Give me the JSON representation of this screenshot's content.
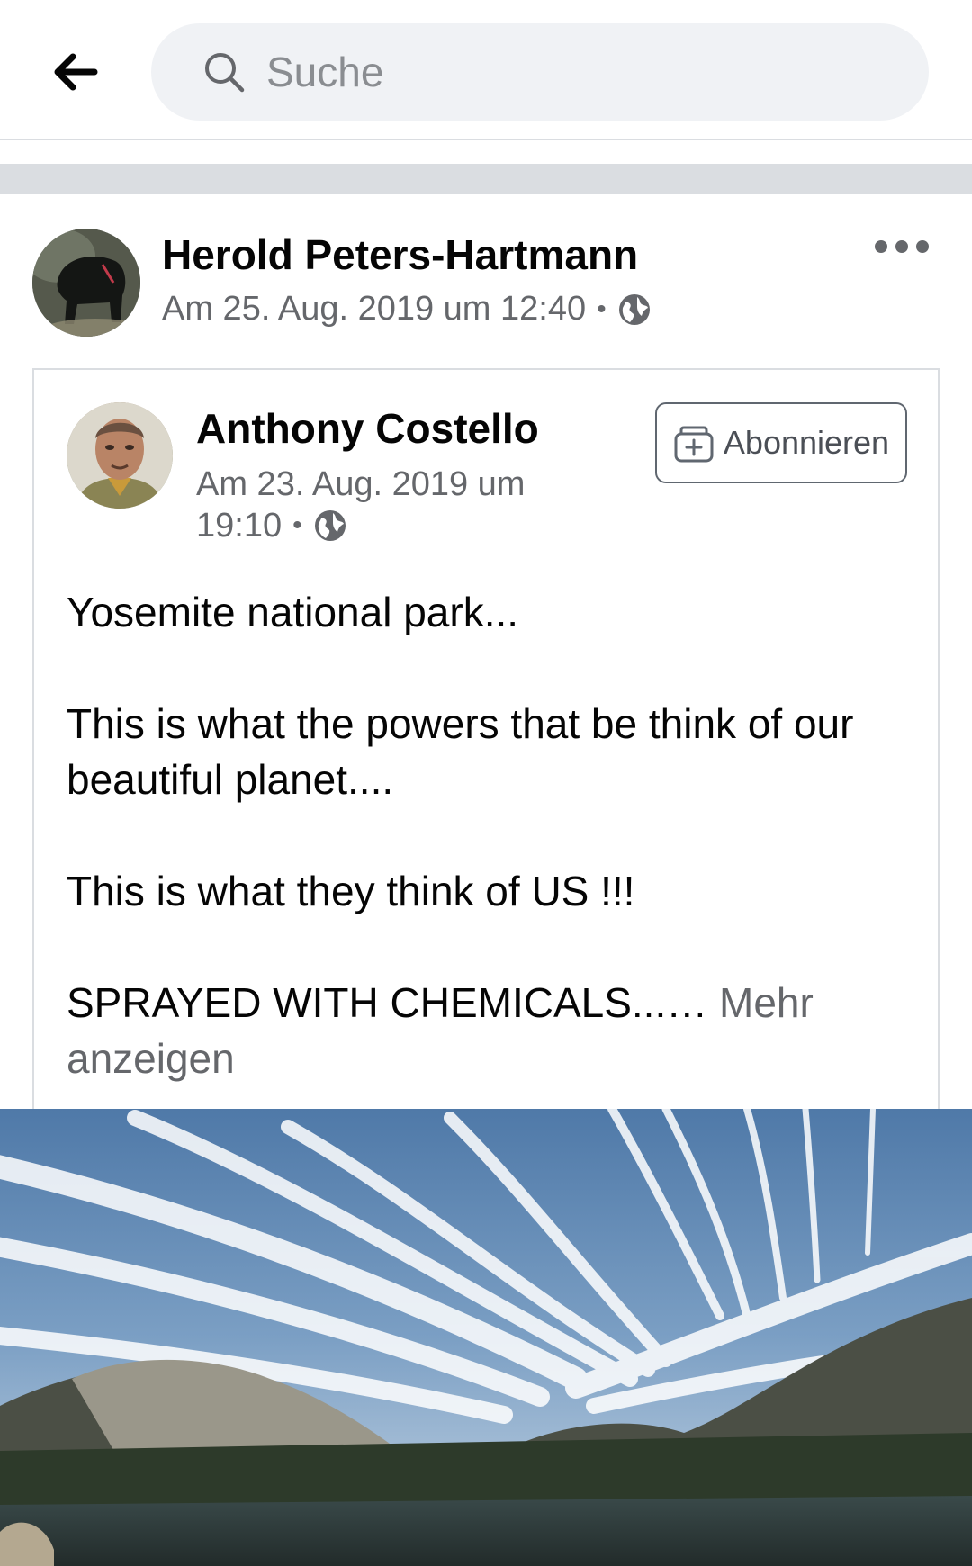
{
  "search": {
    "placeholder": "Suche"
  },
  "post": {
    "author": "Herold Peters-Hartmann",
    "timestamp": "Am 25. Aug. 2019 um 12:40",
    "separator": "•",
    "privacy_icon": "globe-icon"
  },
  "shared_post": {
    "author": "Anthony Costello",
    "timestamp_line1": "Am 23. Aug. 2019 um",
    "timestamp_line2": "19:10",
    "separator": "•",
    "follow_label": "Abonnieren",
    "text": {
      "p1": "Yosemite national park...",
      "p2": "This is what the powers that be think of our beautiful planet....",
      "p3": "This is what they think of US !!!",
      "p4": "SPRAYED WITH CHEMICALS...…",
      "see_more": "Mehr anzeigen"
    }
  },
  "colors": {
    "secondary_text": "#65676b",
    "search_bg": "#f0f2f5",
    "divider": "#dadde1"
  }
}
